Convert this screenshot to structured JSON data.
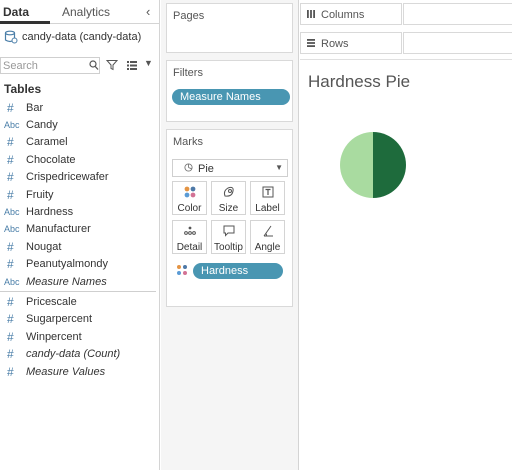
{
  "colors": {
    "pill": "#4996b2",
    "pie_light": "#a9dba0",
    "pie_dark": "#1e6b3c",
    "field_icon": "#4a7ea8"
  },
  "data_pane": {
    "tab_data": "Data",
    "tab_analytics": "Analytics",
    "collapse_icon": "chevron-left-icon",
    "datasource_name": "candy-data (candy-data)",
    "search_placeholder": "Search",
    "tables_title": "Tables",
    "fields": [
      {
        "type": "measure",
        "icon": "#",
        "name": "Bar",
        "italic": false
      },
      {
        "type": "dimension",
        "icon": "Abc",
        "name": "Candy",
        "italic": false
      },
      {
        "type": "measure",
        "icon": "#",
        "name": "Caramel",
        "italic": false
      },
      {
        "type": "measure",
        "icon": "#",
        "name": "Chocolate",
        "italic": false
      },
      {
        "type": "measure",
        "icon": "#",
        "name": "Crispedricewafer",
        "italic": false
      },
      {
        "type": "measure",
        "icon": "#",
        "name": "Fruity",
        "italic": false
      },
      {
        "type": "dimension",
        "icon": "Abc",
        "name": "Hardness",
        "italic": false
      },
      {
        "type": "dimension",
        "icon": "Abc",
        "name": "Manufacturer",
        "italic": false
      },
      {
        "type": "measure",
        "icon": "#",
        "name": "Nougat",
        "italic": false
      },
      {
        "type": "measure",
        "icon": "#",
        "name": "Peanutyalmondy",
        "italic": false
      },
      {
        "type": "dimension",
        "icon": "Abc",
        "name": "Measure Names",
        "italic": true
      },
      {
        "type": "separator"
      },
      {
        "type": "measure",
        "icon": "#",
        "name": "Pricescale",
        "italic": false
      },
      {
        "type": "measure",
        "icon": "#",
        "name": "Sugarpercent",
        "italic": false
      },
      {
        "type": "measure",
        "icon": "#",
        "name": "Winpercent",
        "italic": false
      },
      {
        "type": "measure",
        "icon": "#",
        "name": "candy-data (Count)",
        "italic": true
      },
      {
        "type": "measure",
        "icon": "#",
        "name": "Measure Values",
        "italic": true
      }
    ]
  },
  "pages": {
    "title": "Pages"
  },
  "filters": {
    "title": "Filters",
    "pill": "Measure Names"
  },
  "marks": {
    "title": "Marks",
    "mark_type": "Pie",
    "buttons": {
      "color": "Color",
      "size": "Size",
      "label": "Label",
      "detail": "Detail",
      "tooltip": "Tooltip",
      "angle": "Angle"
    },
    "color_field": "Hardness"
  },
  "shelves": {
    "columns": "Columns",
    "rows": "Rows"
  },
  "view": {
    "title": "Hardness Pie",
    "pie_slices": [
      {
        "label": "dark",
        "fraction": 0.5
      },
      {
        "label": "light",
        "fraction": 0.5
      }
    ]
  }
}
